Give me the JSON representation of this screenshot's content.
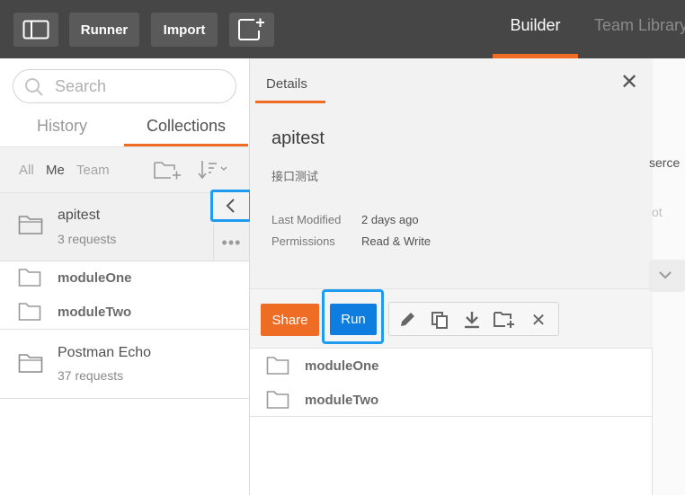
{
  "topbar": {
    "runner_label": "Runner",
    "import_label": "Import",
    "tab_builder": "Builder",
    "tab_team": "Team Library"
  },
  "sidebar": {
    "search_placeholder": "Search",
    "tabs": [
      "History",
      "Collections"
    ],
    "filters": [
      "All",
      "Me",
      "Team"
    ],
    "collections": [
      {
        "name": "apitest",
        "requests": "3 requests",
        "folders": [
          "moduleOne",
          "moduleTwo"
        ]
      },
      {
        "name": "Postman Echo",
        "requests": "37 requests"
      }
    ]
  },
  "details": {
    "tab": "Details",
    "name": "apitest",
    "description": "接口测试",
    "last_modified_label": "Last Modified",
    "last_modified_value": "2 days ago",
    "permissions_label": "Permissions",
    "permissions_value": "Read & Write",
    "share_label": "Share",
    "run_label": "Run",
    "folders": [
      "moduleOne",
      "moduleTwo"
    ]
  },
  "background": {
    "text1": "serce",
    "text2": "ot"
  },
  "colors": {
    "accent": "#ef6c24",
    "run": "#0f7ce0",
    "highlight": "#1f9bf0"
  }
}
